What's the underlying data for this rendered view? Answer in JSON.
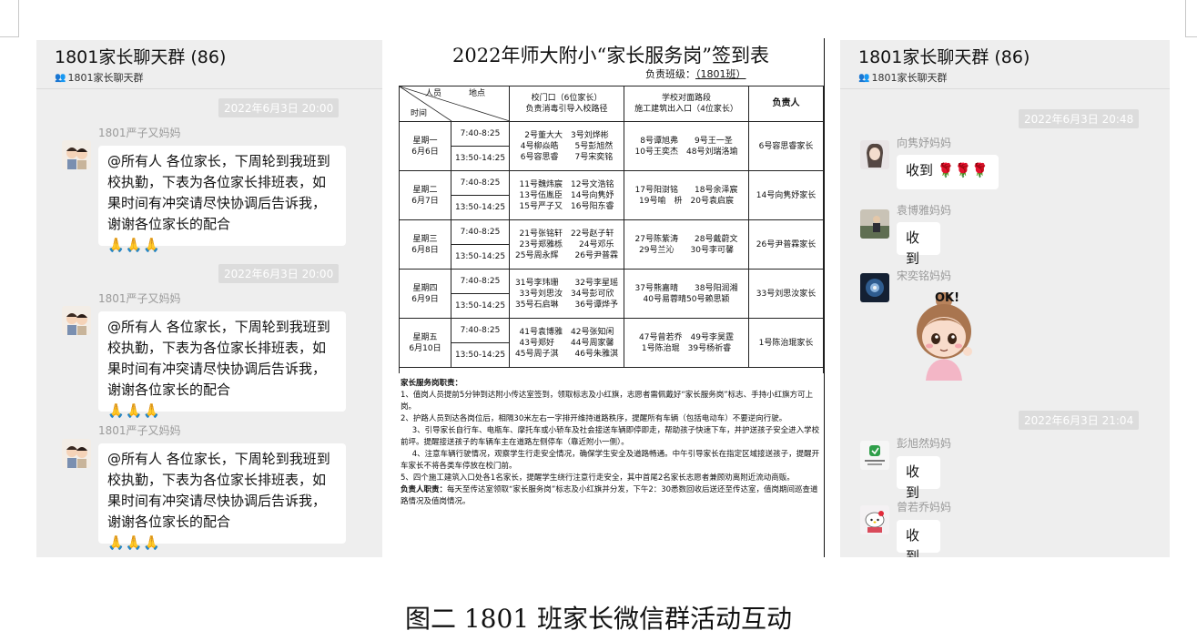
{
  "left_chat": {
    "title": "1801家长聊天群 (86)",
    "subtitle": "1801家长聊天群",
    "messages": [
      {
        "timestamp": "2022年6月3日 20:00",
        "sender": "1801严子又妈妈",
        "text": "@所有人 各位家长，下周轮到我班到校执勤，下表为各位家长排班表，如果时间有冲突请尽快协调后告诉我，谢谢各位家长的配合",
        "emoji": "🙏🙏🙏"
      },
      {
        "timestamp": "2022年6月3日 20:00",
        "sender": "1801严子又妈妈",
        "text": "@所有人 各位家长，下周轮到我班到校执勤，下表为各位家长排班表，如果时间有冲突请尽快协调后告诉我，谢谢各位家长的配合",
        "emoji": "🙏🙏🙏"
      },
      {
        "timestamp": "",
        "sender": "1801严子又妈妈",
        "text": "@所有人 各位家长，下周轮到我班到校执勤，下表为各位家长排班表，如果时间有冲突请尽快协调后告诉我，谢谢各位家长的配合",
        "emoji": "🙏🙏🙏"
      }
    ]
  },
  "right_chat": {
    "title": "1801家长聊天群 (86)",
    "subtitle": "1801家长聊天群",
    "timestamps": [
      "2022年6月3日 20:48",
      "2022年6月3日 21:04"
    ],
    "messages": [
      {
        "sender": "向隽妤妈妈",
        "text": "收到",
        "emoji": "🌹🌹🌹"
      },
      {
        "sender": "袁博雅妈妈",
        "text": "收到"
      },
      {
        "sender": "宋奕铭妈妈",
        "sticker_text": "OK!"
      },
      {
        "sender": "彭旭然妈妈",
        "text": "收到"
      },
      {
        "sender": "曾若乔妈妈",
        "text": "收到"
      }
    ]
  },
  "form": {
    "title": "2022年师大附小“家长服务岗”签到表",
    "class_label": "负责班级：",
    "class_value": "（1801班）",
    "header": {
      "personnel": "人员",
      "location": "地点",
      "time": "时间",
      "gate": "校门口（6位家长）",
      "gate_sub": "负责消毒引导入校路径",
      "road": "学校对面路段",
      "road_sub": "施工建筑出入口（4位家长）",
      "responsible": "负责人"
    },
    "rows": [
      {
        "day": "星期一",
        "date": "6月6日",
        "t1": "7:40-8:25",
        "t2": "13:50-14:25",
        "gate": [
          "2号董大大　3号刘烨彬",
          "4号柳焱皓　　5号彭旭然",
          "6号容思睿　　7号宋奕铭"
        ],
        "road": [
          "8号谭旭弗　　9号王一圣",
          "10号王奕杰　48号刘瑞洛瑜"
        ],
        "lead": "6号容思睿家长"
      },
      {
        "day": "星期二",
        "date": "6月7日",
        "t1": "7:40-8:25",
        "t2": "13:50-14:25",
        "gate": [
          "11号魏炜宸　12号文浩铭",
          "13号伍胤臣　14号向隽妤",
          "15号严子又　16号阳东睿"
        ],
        "road": [
          "17号阳澍铭　　18号余泽宸",
          "19号喻　枡　20号袁启宸"
        ],
        "lead": "14号向隽妤家长"
      },
      {
        "day": "星期三",
        "date": "6月8日",
        "t1": "7:40-8:25",
        "t2": "13:50-14:25",
        "gate": [
          "21号张铭轩　22号赵子轩",
          "23号郑雅栎　　24号邓乐",
          "25号周永辉　　26号尹普霖"
        ],
        "road": [
          "27号陈紫涛　　28号戴蔚文",
          "29号兰沁　　30号李可馨"
        ],
        "lead": "26号尹普霖家长"
      },
      {
        "day": "星期四",
        "date": "6月9日",
        "t1": "7:40-8:25",
        "t2": "13:50-14:25",
        "gate": [
          "31号李玮珊　　32号李星瑶",
          "33号刘思汝　34号彭可欣",
          "35号石启琳　　36号谭烨予"
        ],
        "road": [
          "37号熊嘉晴　　38号阳润湘",
          "40号易蓉晴50号赖思颖"
        ],
        "lead": "33号刘思汝家长"
      },
      {
        "day": "星期五",
        "date": "6月10日",
        "t1": "7:40-8:25",
        "t2": "13:50-14:25",
        "gate": [
          "41号袁博雅　42号张知闲",
          "43号郑好　　44号周家馨",
          "45号周子淇　　46号朱雅淇"
        ],
        "road": [
          "47号曾若乔　49号李昊霆",
          "1号陈治琨　39号杨祈睿"
        ],
        "lead": "1号陈治琨家长"
      }
    ],
    "duties_title": "家长服务岗职责：",
    "duties": [
      "1、值岗人员提前5分钟到达附小传达室签到，领取标志及小红旗，志愿者需佩戴好“家长服务岗”标志、手持小红旗方可上岗。",
      "2、护路人员到达各岗位后，相隔30米左右一字排开维持道路秩序，提醒所有车辆（包括电动车）不要逆向行驶。",
      "3、引导家长自行车、电瓶车、摩托车或小轿车及社会接送车辆即停即走，帮助孩子快速下车，并护送孩子安全进入学校前坪。提醒接送孩子的车辆车主在道路左侧停车（靠近附小一侧）。",
      "4、注意车辆行驶情况，观察学生行走安全情况，确保学生安全及道路畅通。中午引导家长在指定区域接送孩子，提醒开车家长不将各类车停放在校门前。",
      "5、四个施工建筑入口处各1名家长，提醒学生绕行注意行走安全，其中首尾2名家长志愿者兼顾劝离附近流动商贩。"
    ],
    "lead_duty_label": "负责人职责：",
    "lead_duty": "每天至传达室领取“家长服务岗”标志及小红旗并分发，下午2：30悉数回收后送还至传达室，值岗期间巡查道路情况及值岗情况。"
  },
  "caption": "图二  1801 班家长微信群活动互动",
  "colors": {
    "panel": "#eeeeee",
    "bubble": "#ffffff",
    "timestamp_bg": "#dcdcdc",
    "sender": "#9a9a9a"
  }
}
